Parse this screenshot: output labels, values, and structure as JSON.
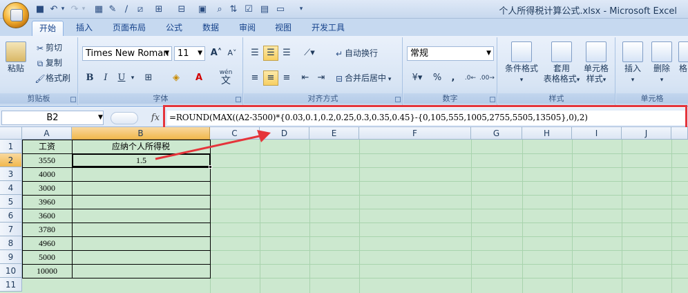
{
  "window_title": "个人所得税计算公式.xlsx - Microsoft Excel",
  "tabs": [
    {
      "label": "开始",
      "active": true
    },
    {
      "label": "插入"
    },
    {
      "label": "页面布局"
    },
    {
      "label": "公式"
    },
    {
      "label": "数据"
    },
    {
      "label": "审阅"
    },
    {
      "label": "视图"
    },
    {
      "label": "开发工具"
    }
  ],
  "clipboard": {
    "paste": "粘贴",
    "cut": "剪切",
    "copy": "复制",
    "format_painter": "格式刷",
    "label": "剪贴板"
  },
  "font": {
    "name": "Times New Roman",
    "size": "11",
    "bold": "B",
    "italic": "I",
    "underline": "U",
    "label": "字体",
    "wen": "wén",
    "wen_char": "文"
  },
  "alignment": {
    "wrap": "自动换行",
    "merge": "合并后居中",
    "label": "对齐方式"
  },
  "number": {
    "format": "常规",
    "percent": "%",
    "comma": ",",
    "label": "数字"
  },
  "styles": {
    "conditional": "条件格式",
    "table": "套用",
    "table2": "表格格式",
    "cell": "单元格",
    "cell2": "样式",
    "label": "样式"
  },
  "cells": {
    "insert": "插入",
    "delete": "删除",
    "format": "格",
    "label": "单元格"
  },
  "formula_bar": {
    "name_box": "B2",
    "fx": "fx",
    "formula": "=ROUND(MAX((A2-3500)*{0.03,0.1,0.2,0.25,0.3,0.35,0.45}-{0,105,555,1005,2755,5505,13505},0),2)"
  },
  "columns": [
    "A",
    "B",
    "C",
    "D",
    "E",
    "F",
    "G",
    "H",
    "I",
    "J"
  ],
  "rows": [
    "1",
    "2",
    "3",
    "4",
    "5",
    "6",
    "7",
    "8",
    "9",
    "10",
    "11"
  ],
  "sheet": {
    "header_a": "工资",
    "header_b": "应纳个人所得税",
    "salaries": [
      "3550",
      "4000",
      "3000",
      "3960",
      "3600",
      "3780",
      "4960",
      "5000",
      "10000"
    ],
    "b2_value": "1.5"
  },
  "colors": {
    "annotation": "#e5343b",
    "grid_bg": "#cce8cf"
  }
}
